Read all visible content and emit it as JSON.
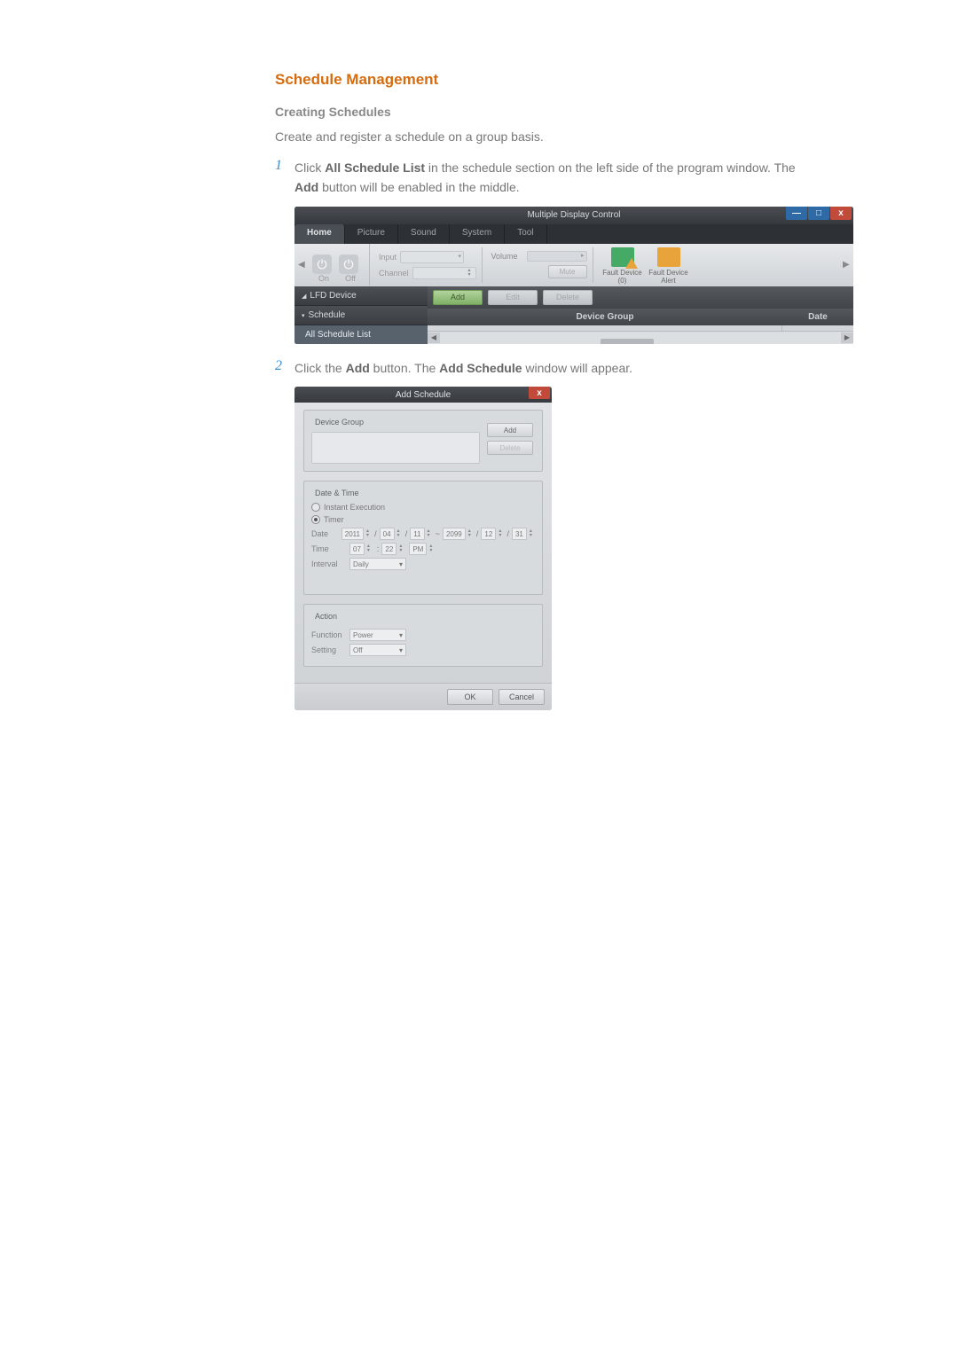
{
  "title": "Schedule Management",
  "subsection": "Creating Schedules",
  "intro": "Create and register a schedule on a group basis.",
  "steps": {
    "s1": {
      "num": "1",
      "pre": "Click ",
      "b1": "All Schedule List",
      "mid": " in the schedule section on the left side of the program window. The ",
      "b2": "Add",
      "post": " button will be enabled in the middle."
    },
    "s2": {
      "num": "2",
      "pre": "Click the ",
      "b1": "Add",
      "mid": " button. The ",
      "b2": "Add Schedule",
      "post": " window will appear."
    }
  },
  "mdc": {
    "window_title": "Multiple Display Control",
    "tabs": [
      "Home",
      "Picture",
      "Sound",
      "System",
      "Tool"
    ],
    "toolbar": {
      "on": "On",
      "off": "Off",
      "input": "Input",
      "channel": "Channel",
      "volume": "Volume",
      "mute": "Mute",
      "fault_device": "Fault Device",
      "fault_count": "(0)",
      "fault_alert": "Fault Device Alert"
    },
    "side": {
      "lfd": "LFD Device",
      "schedule": "Schedule",
      "all_list": "All Schedule List"
    },
    "buttons": {
      "add": "Add",
      "edit": "Edit",
      "delete": "Delete"
    },
    "cols": {
      "device_group": "Device Group",
      "date": "Date"
    },
    "help": "?"
  },
  "asw": {
    "title": "Add Schedule",
    "device_group": "Device Group",
    "add_btn": "Add",
    "delete_btn": "Delete",
    "date_time": "Date & Time",
    "instant": "Instant Execution",
    "timer": "Timer",
    "date_label": "Date",
    "date_values": {
      "y1": "2011",
      "m1": "04",
      "d1": "11",
      "sep": "~",
      "y2": "2099",
      "m2": "12",
      "d2": "31"
    },
    "time_label": "Time",
    "time_values": {
      "h": "07",
      "m": "22",
      "ampm": "PM"
    },
    "interval_label": "Interval",
    "interval_value": "Daily",
    "action": "Action",
    "function_label": "Function",
    "function_value": "Power",
    "setting_label": "Setting",
    "setting_value": "Off",
    "ok": "OK",
    "cancel": "Cancel"
  },
  "win_glyphs": {
    "min": "—",
    "max": "□",
    "close": "x"
  },
  "chart_data": null
}
